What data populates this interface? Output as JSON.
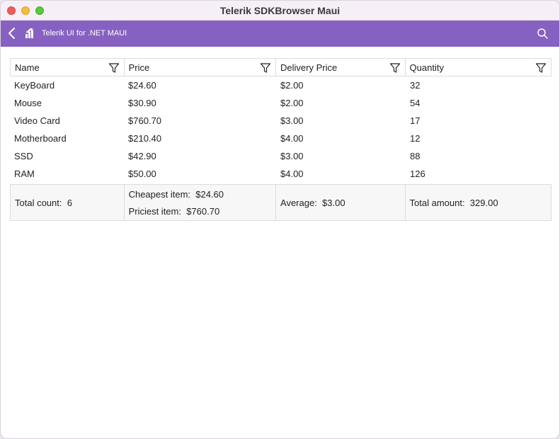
{
  "window": {
    "title": "Telerik SDKBrowser Maui"
  },
  "appbar": {
    "title": "Telerik UI for .NET MAUI"
  },
  "grid": {
    "columns": [
      "Name",
      "Price",
      "Delivery Price",
      "Quantity"
    ],
    "rows": [
      [
        "KeyBoard",
        "$24.60",
        "$2.00",
        "32"
      ],
      [
        "Mouse",
        "$30.90",
        "$2.00",
        "54"
      ],
      [
        "Video Card",
        "$760.70",
        "$3.00",
        "17"
      ],
      [
        "Motherboard",
        "$210.40",
        "$4.00",
        "12"
      ],
      [
        "SSD",
        "$42.90",
        "$3.00",
        "88"
      ],
      [
        "RAM",
        "$50.00",
        "$4.00",
        "126"
      ]
    ],
    "footer": {
      "name": "Total count:  6",
      "price_min": "Cheapest item:  $24.60",
      "price_max": "Priciest item:  $760.70",
      "delivery": "Average:  $3.00",
      "quantity": "Total amount:  329.00"
    }
  },
  "colors": {
    "accent": "#8661c1",
    "footer_bg": "#f7f7f7",
    "grid_line": "#dcdcdc"
  }
}
